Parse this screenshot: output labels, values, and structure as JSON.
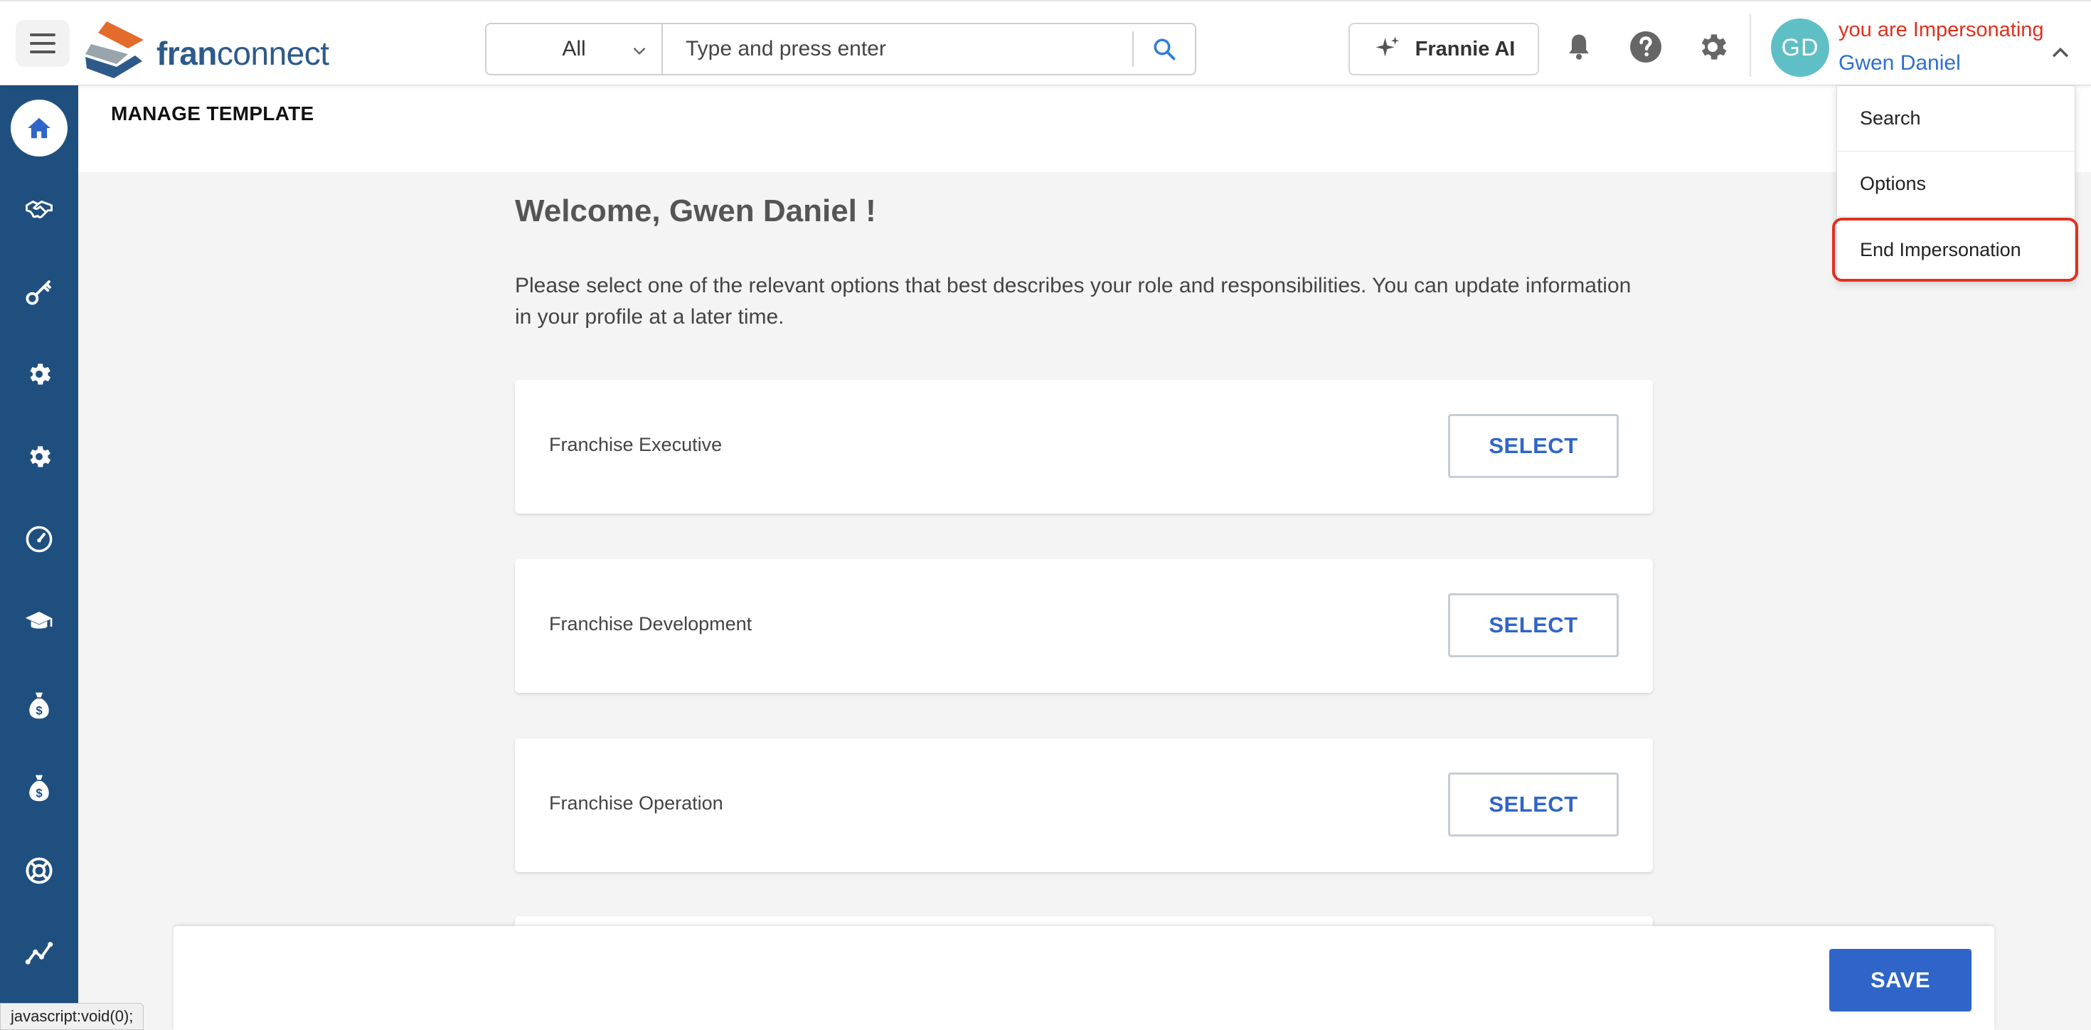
{
  "header": {
    "logo_text_a": "fran",
    "logo_text_b": "connect",
    "search_scope": "All",
    "search_placeholder": "Type and press enter",
    "ai_button_label": "Frannie AI",
    "impersonation_label": "you are Impersonating",
    "impersonated_user": "Gwen Daniel",
    "avatar_initials": "GD"
  },
  "user_menu": {
    "items": [
      "Search",
      "Options",
      "End Impersonation"
    ]
  },
  "sidebar": {
    "items": [
      "home-icon",
      "handshake-icon",
      "key-icon",
      "gear-icon",
      "gear-icon",
      "speedometer-icon",
      "graduation-cap-icon",
      "money-bag-icon",
      "money-bag-icon",
      "lifebuoy-icon",
      "line-chart-icon"
    ]
  },
  "page": {
    "title": "MANAGE TEMPLATE",
    "welcome": "Welcome, Gwen Daniel !",
    "intro": "Please select one of the relevant options that best describes your role and responsibilities. You can update information in your profile at a later time."
  },
  "roles": [
    {
      "label": "Franchise Executive",
      "button": "SELECT"
    },
    {
      "label": "Franchise Development",
      "button": "SELECT"
    },
    {
      "label": "Franchise Operation",
      "button": "SELECT"
    }
  ],
  "footer": {
    "save_label": "SAVE"
  },
  "status_bar": {
    "url": "javascript:void(0);"
  },
  "colors": {
    "primary": "#2f65c8",
    "sidebar": "#1f4f7f",
    "alert": "#e0301e",
    "avatar": "#5fbfc6",
    "logo_orange": "#e36b2c"
  }
}
